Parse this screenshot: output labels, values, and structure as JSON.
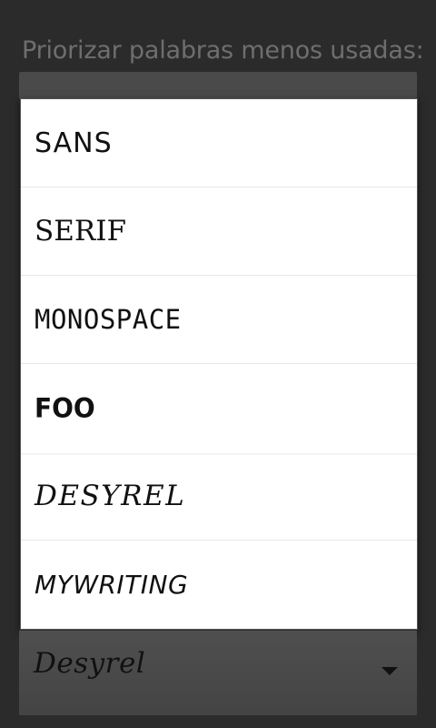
{
  "setting": {
    "label": "Priorizar palabras menos usadas:"
  },
  "spinner": {
    "selected_value": "Desyrel",
    "arrow_icon": "dropdown-arrow-icon"
  },
  "dropdown": {
    "options": [
      {
        "label": "SANS"
      },
      {
        "label": "SERIF"
      },
      {
        "label": "MONOSPACE"
      },
      {
        "label": "FOO"
      },
      {
        "label": "DESYREL"
      },
      {
        "label": "MYWRITING"
      }
    ]
  },
  "colors": {
    "background": "#2b2b2b",
    "popup_background": "#ffffff",
    "label_text": "#6e6e6e",
    "spinner_background": "#4a4a4a"
  }
}
